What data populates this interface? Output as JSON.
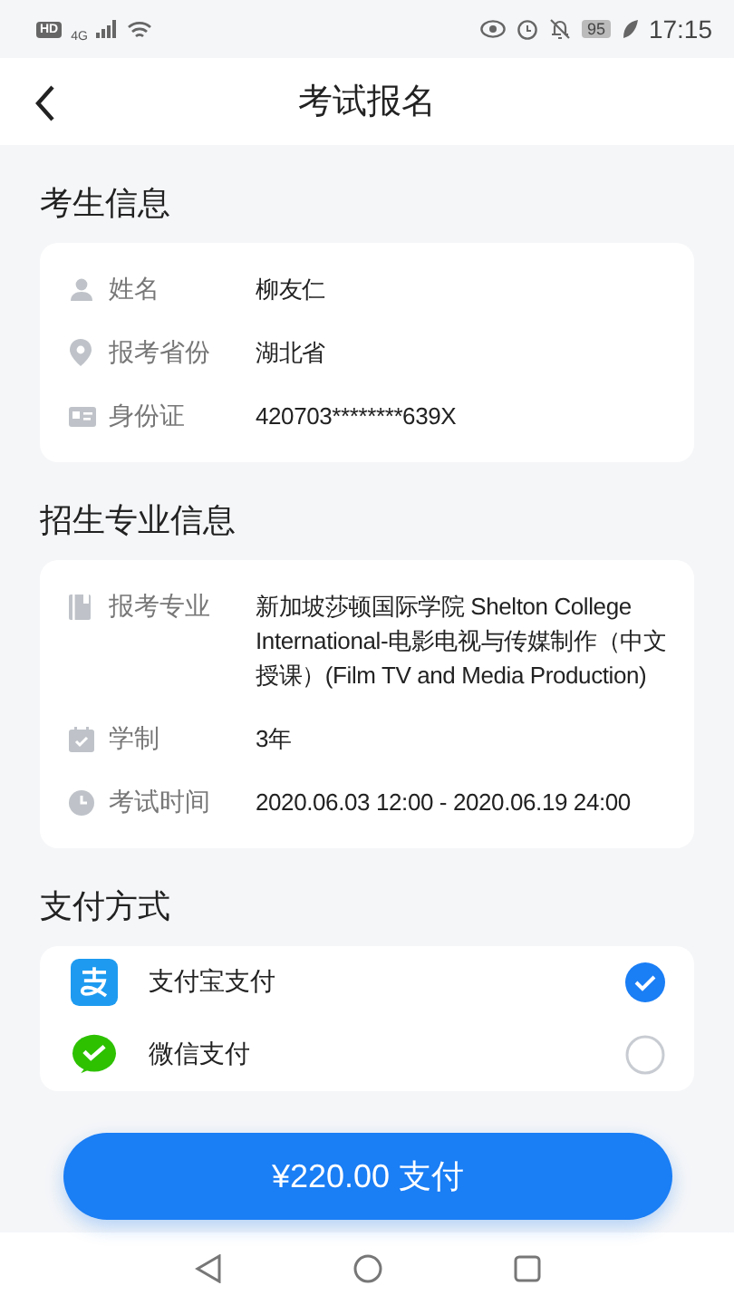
{
  "status_bar": {
    "hd_badge": "HD",
    "network": "4G",
    "battery": "95",
    "time": "17:15"
  },
  "header": {
    "title": "考试报名"
  },
  "sections": [
    {
      "title": "考生信息",
      "rows": [
        {
          "kind": "person",
          "label": "姓名",
          "value": "柳友仁"
        },
        {
          "kind": "location",
          "label": "报考省份",
          "value": "湖北省"
        },
        {
          "kind": "id-card",
          "label": "身份证",
          "value": "420703********639X"
        }
      ]
    },
    {
      "title": "招生专业信息",
      "rows": [
        {
          "kind": "book",
          "label": "报考专业",
          "value": "新加坡莎顿国际学院 Shelton College International-电影电视与传媒制作（中文授课）(Film TV and Media Production)"
        },
        {
          "kind": "calendar",
          "label": "学制",
          "value": "3年"
        },
        {
          "kind": "clock",
          "label": "考试时间",
          "value": "2020.06.03 12:00 - 2020.06.19 24:00"
        }
      ]
    }
  ],
  "payment": {
    "title": "支付方式",
    "methods": [
      {
        "kind": "alipay",
        "label": "支付宝支付",
        "selected": true
      },
      {
        "kind": "wechat",
        "label": "微信支付",
        "selected": false
      }
    ]
  },
  "pay_button": {
    "label": "¥220.00 支付"
  }
}
